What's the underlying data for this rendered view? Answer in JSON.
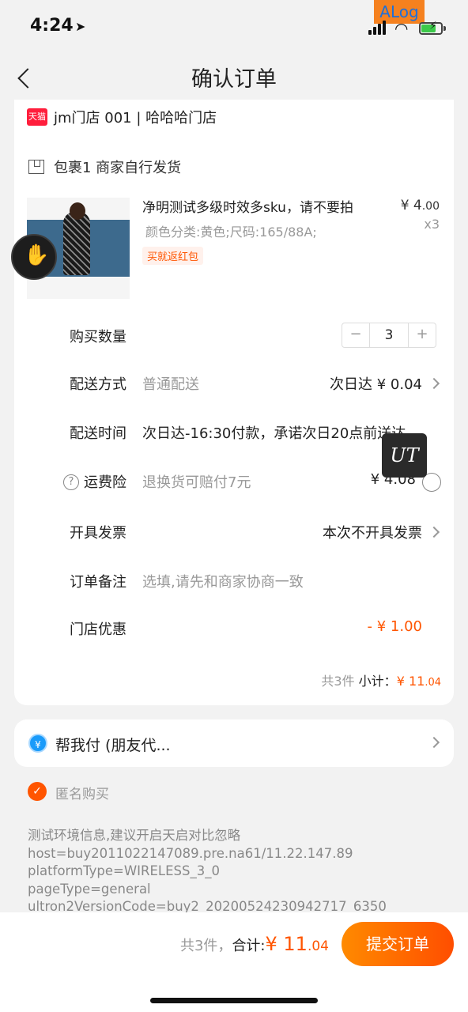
{
  "status": {
    "time": "4:24",
    "alog": "ALog"
  },
  "nav": {
    "title": "确认订单"
  },
  "shop": {
    "badge": "天猫",
    "name": "jm门店 001 | 哈哈哈门店"
  },
  "package": {
    "label": "包裹1 商家自行发货"
  },
  "product": {
    "title": "净明测试多级时效多sku，请不要拍",
    "spec": "颜色分类:黄色;尺码:165/88A;",
    "tag": "买就返红包",
    "price_main": "¥ 4",
    "price_cents": ".00",
    "qty": "x3"
  },
  "rows": {
    "quantity": {
      "label": "购买数量",
      "value": "3",
      "minus": "−",
      "plus": "+"
    },
    "shipping": {
      "label": "配送方式",
      "sub": "普通配送",
      "value": "次日达 ¥ 0.04"
    },
    "delivery_time": {
      "label": "配送时间",
      "sub": "次日达-16:30付款，承诺次日20点前送达"
    },
    "insurance": {
      "label": "运费险",
      "sub": "退换货可赔付7元",
      "value": "¥ 4.08",
      "help": "?"
    },
    "invoice": {
      "label": "开具发票",
      "value": "本次不开具发票"
    },
    "remark": {
      "label": "订单备注",
      "placeholder": "选填,请先和商家协商一致"
    },
    "store_discount": {
      "label": "门店优惠",
      "value": "- ¥ 1.00"
    }
  },
  "ut_badge": "UT",
  "subtotal": {
    "count": "共3件",
    "label": "小计：",
    "amount": "¥ 11",
    "cents": ".04"
  },
  "friend_pay": {
    "icon": "¥",
    "label": "帮我付 (朋友代..."
  },
  "anonymous": {
    "label": "匿名购买",
    "checked": true
  },
  "debug": [
    "测试环境信息,建议开启天启对比忽略",
    "host=buy2011022147089.pre.na61/11.22.147.89",
    "platformType=WIRELESS_3_0",
    "pageType=general",
    "ultron2VersionCode=buy2_20200524230942717_6350"
  ],
  "footer": {
    "count": "共3件，",
    "label": "合计:",
    "amount": "¥ 11",
    "cents": ".04",
    "submit": "提交订单"
  }
}
